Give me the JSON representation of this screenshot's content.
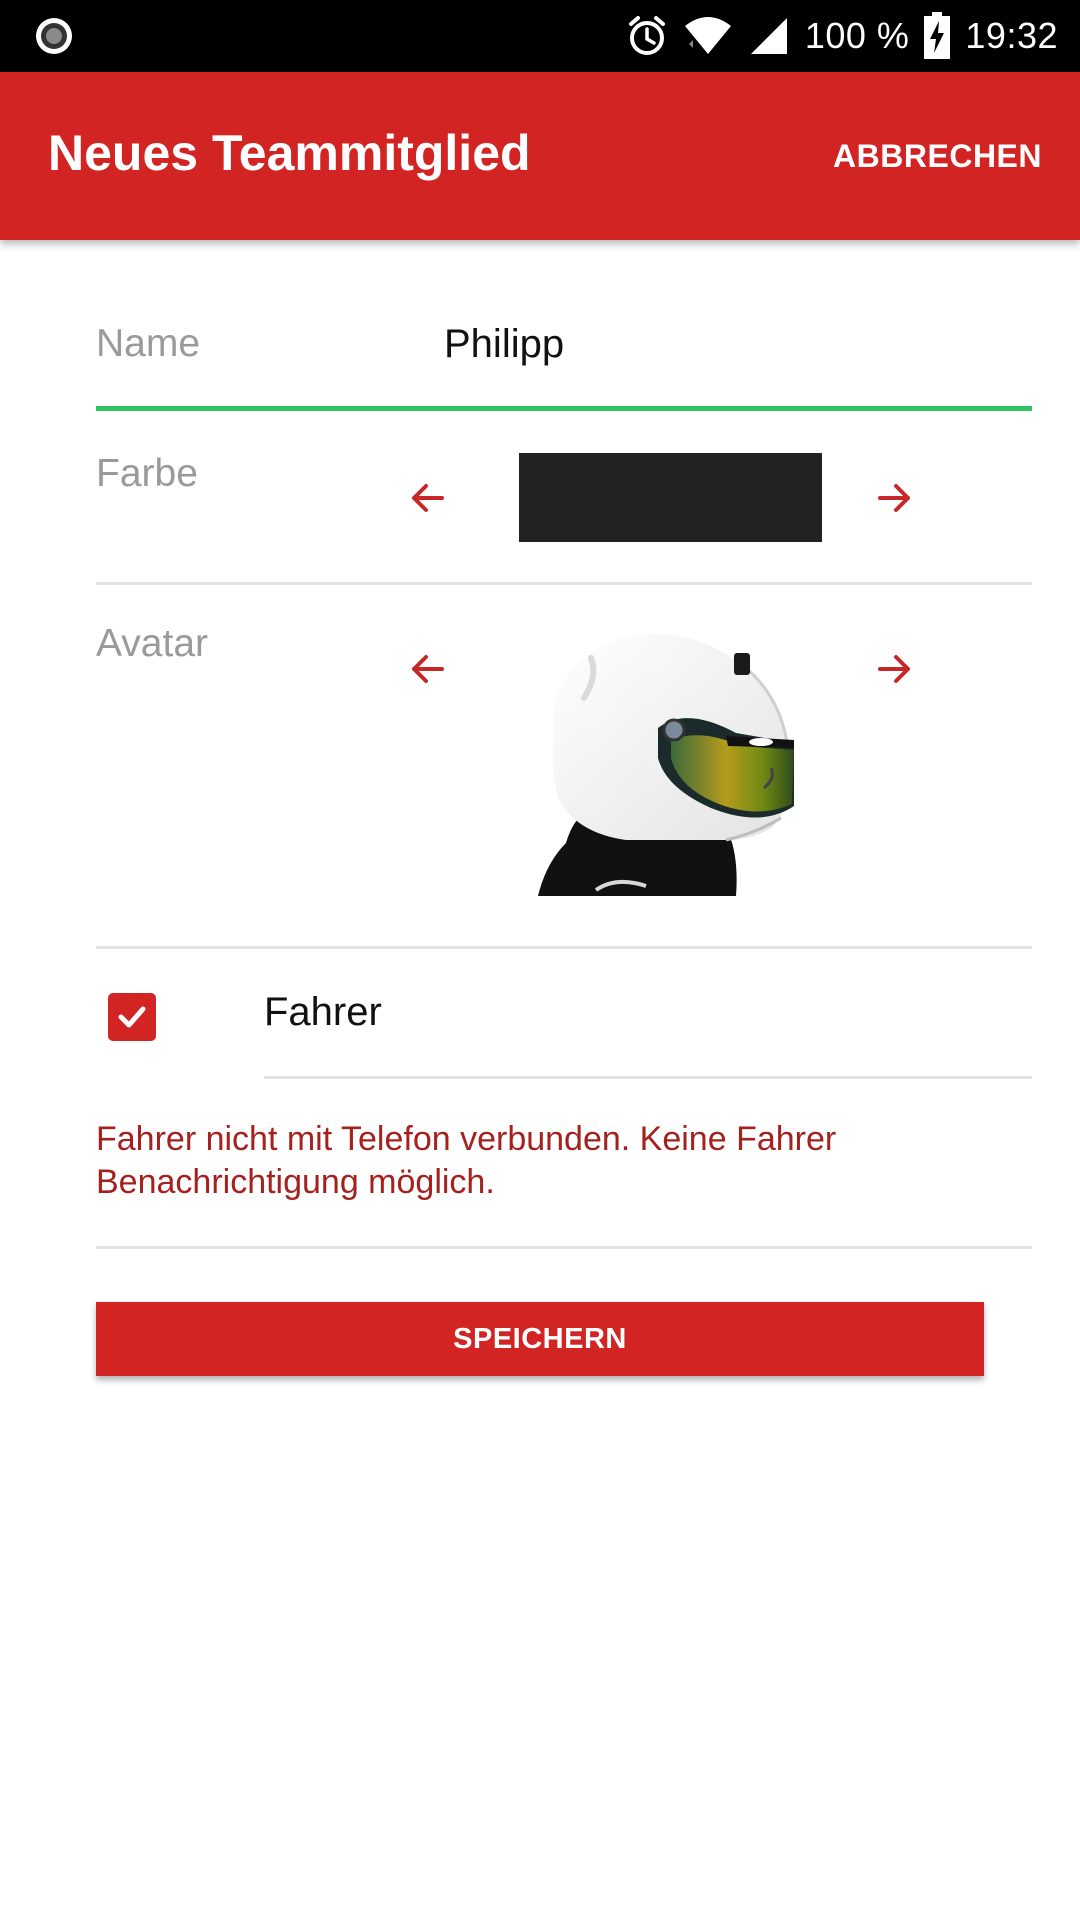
{
  "status_bar": {
    "left_icon": "record-icon",
    "battery_percent": "100 %",
    "time": "19:32",
    "icons": [
      "alarm-icon",
      "wifi-icon",
      "signal-icon",
      "battery-charging-icon"
    ]
  },
  "app_bar": {
    "title": "Neues Teammitglied",
    "action_label": "ABBRECHEN",
    "color": "#d32424"
  },
  "form": {
    "name": {
      "label": "Name",
      "value": "Philipp",
      "underline_color": "#2fc45e"
    },
    "color": {
      "label": "Farbe",
      "selected_color": "#222222",
      "prev_icon": "arrow-left-icon",
      "next_icon": "arrow-right-icon"
    },
    "avatar": {
      "label": "Avatar",
      "image": "racing-helmet",
      "prev_icon": "arrow-left-icon",
      "next_icon": "arrow-right-icon"
    },
    "driver": {
      "label": "Fahrer",
      "checked": true
    },
    "warning": "Fahrer nicht mit Telefon verbunden. Keine Fahrer Benachrichtigung möglich.",
    "save_label": "SPEICHERN"
  },
  "colors": {
    "accent": "#d32424",
    "warning_text": "#a5211e",
    "arrow": "#c62828"
  }
}
